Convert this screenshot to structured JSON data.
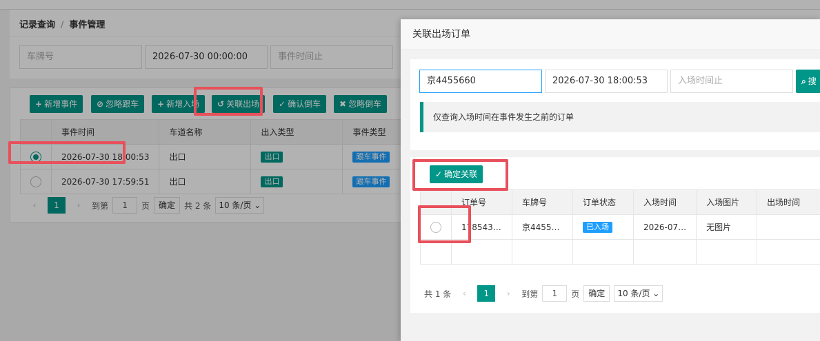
{
  "breadcrumb": {
    "item1": "记录查询",
    "sep": "/",
    "item2": "事件管理"
  },
  "filters": {
    "plate_placeholder": "车牌号",
    "time_start_value": "2026-07-30 00:00:00",
    "time_end_placeholder": "事件时间止"
  },
  "toolbar": [
    {
      "icon": "+",
      "label": "新增事件"
    },
    {
      "icon": "⊘",
      "label": "忽略跟车"
    },
    {
      "icon": "+",
      "label": "新增入场"
    },
    {
      "icon": "↺",
      "label": "关联出场"
    },
    {
      "icon": "✓",
      "label": "确认倒车"
    },
    {
      "icon": "✖",
      "label": "忽略倒车"
    }
  ],
  "events_table": {
    "headers": [
      "",
      "事件时间",
      "车道名称",
      "出入类型",
      "事件类型"
    ],
    "rows": [
      {
        "selected": true,
        "time": "2026-07-30 18:00:53",
        "lane": "出口",
        "io_type": "出口",
        "event_type": "跟车事件"
      },
      {
        "selected": false,
        "time": "2026-07-30 17:59:51",
        "lane": "出口",
        "io_type": "出口",
        "event_type": "跟车事件"
      }
    ]
  },
  "events_pager": {
    "prev": "‹",
    "page": "1",
    "next": "›",
    "goto_label": "到第",
    "goto_value": "1",
    "page_unit": "页",
    "confirm": "确定",
    "total": "共 2 条",
    "page_size": "10 条/页 ⌄"
  },
  "modal": {
    "title": "关联出场订单",
    "plate_value": "京4455660",
    "entry_time_start": "2026-07-30 18:00:53",
    "entry_time_end_placeholder": "入场时间止",
    "search_label": "搜",
    "tip": "仅查询入场时间在事件发生之前的订单",
    "confirm_link_label": "确定关联",
    "orders_table": {
      "headers": [
        "",
        "订单号",
        "车牌号",
        "订单状态",
        "入场时间",
        "入场图片",
        "出场时间"
      ],
      "rows": [
        {
          "selected": false,
          "order_no": "178543…",
          "plate": "京4455…",
          "status": "已入场",
          "entry_time": "2026-07…",
          "entry_image": "无图片",
          "exit_time": ""
        }
      ]
    },
    "pager": {
      "total": "共 1 条",
      "prev": "‹",
      "page": "1",
      "next": "›",
      "goto_label": "到第",
      "goto_value": "1",
      "page_unit": "页",
      "confirm": "确定",
      "page_size": "10 条/页 ⌄"
    }
  },
  "colors": {
    "primary": "#009688",
    "blue_tag": "#1e9fff",
    "highlight": "#e8505b"
  }
}
